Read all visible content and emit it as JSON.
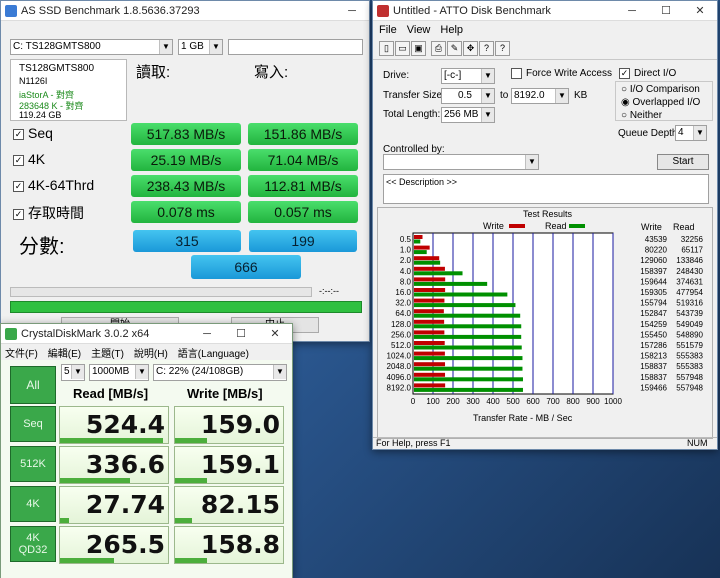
{
  "as_ssd": {
    "title": "AS SSD Benchmark 1.8.5636.37293",
    "drive": "C: TS128GMTS800",
    "size": "1 GB",
    "info": {
      "model": "TS128GMTS800",
      "firmware": "N1126I",
      "driver": "iaStorA - 對齊",
      "offset": "283648 K - 對齊",
      "capacity": "119.24 GB"
    },
    "col_read": "讀取:",
    "col_write": "寫入:",
    "rows": [
      {
        "label": "Seq",
        "read": "517.83 MB/s",
        "write": "151.86 MB/s"
      },
      {
        "label": "4K",
        "read": "25.19 MB/s",
        "write": "71.04 MB/s"
      },
      {
        "label": "4K-64Thrd",
        "read": "238.43 MB/s",
        "write": "112.81 MB/s"
      },
      {
        "label": "存取時間",
        "read": "0.078 ms",
        "write": "0.057 ms"
      }
    ],
    "score_label": "分數:",
    "score_read": "315",
    "score_write": "199",
    "score_total": "666",
    "progress_time": "-:--:--",
    "start_btn": "開始",
    "abort_btn": "中止"
  },
  "cdm": {
    "title": "CrystalDiskMark 3.0.2 x64",
    "menu": [
      "文件(F)",
      "編輯(E)",
      "主題(T)",
      "說明(H)",
      "語言(Language)"
    ],
    "runs": "5",
    "size": "1000MB",
    "drive": "C: 22% (24/108GB)",
    "all": "All",
    "col_read": "Read [MB/s]",
    "col_write": "Write [MB/s]",
    "rows": [
      {
        "label": "Seq",
        "read": "524.4",
        "write": "159.0",
        "rf": 0.95,
        "wf": 0.3
      },
      {
        "label": "512K",
        "read": "336.6",
        "write": "159.1",
        "rf": 0.65,
        "wf": 0.3
      },
      {
        "label": "4K",
        "read": "27.74",
        "write": "82.15",
        "rf": 0.08,
        "wf": 0.16
      },
      {
        "label": "4K\nQD32",
        "read": "265.5",
        "write": "158.8",
        "rf": 0.5,
        "wf": 0.3
      }
    ]
  },
  "atto": {
    "title": "Untitled - ATTO Disk Benchmark",
    "menu": [
      "File",
      "View",
      "Help"
    ],
    "drive_label": "Drive:",
    "drive": "[-c-]",
    "fwa": "Force Write Access",
    "dio": "Direct I/O",
    "ts_label": "Transfer Size:",
    "ts_from": "0.5",
    "ts_to_label": "to",
    "ts_to": "8192.0",
    "ts_unit": "KB",
    "tl_label": "Total Length:",
    "tl": "256 MB",
    "io_comp": "I/O Comparison",
    "ov_io": "Overlapped I/O",
    "neither": "Neither",
    "qd_label": "Queue Depth:",
    "qd": "4",
    "ctrl_label": "Controlled by:",
    "start": "Start",
    "desc": "<< Description >>",
    "results": "Test Results",
    "legend_write": "Write",
    "legend_read": "Read",
    "col_write": "Write",
    "col_read": "Read",
    "xlabel": "Transfer Rate - MB / Sec",
    "status": "For Help, press F1",
    "num": "NUM",
    "ticks": [
      "0",
      "100",
      "200",
      "300",
      "400",
      "500",
      "600",
      "700",
      "800",
      "900",
      "1000"
    ]
  },
  "chart_data": {
    "type": "bar",
    "xlabel": "Transfer Rate - MB / Sec",
    "xlim": [
      0,
      1000
    ],
    "categories": [
      "0.5",
      "1.0",
      "2.0",
      "4.0",
      "8.0",
      "16.0",
      "32.0",
      "64.0",
      "128.0",
      "256.0",
      "512.0",
      "1024.0",
      "2048.0",
      "4096.0",
      "8192.0"
    ],
    "series": [
      {
        "name": "Write",
        "color": "#c00000",
        "values": [
          43539,
          80220,
          129060,
          158397,
          159644,
          159305,
          155794,
          152847,
          154259,
          155450,
          157286,
          158213,
          158837,
          158837,
          159466
        ]
      },
      {
        "name": "Read",
        "color": "#009000",
        "values": [
          32256,
          65117,
          133846,
          248430,
          374631,
          477954,
          519316,
          543739,
          549049,
          548890,
          551579,
          555383,
          555383,
          557948,
          557948
        ]
      }
    ]
  }
}
